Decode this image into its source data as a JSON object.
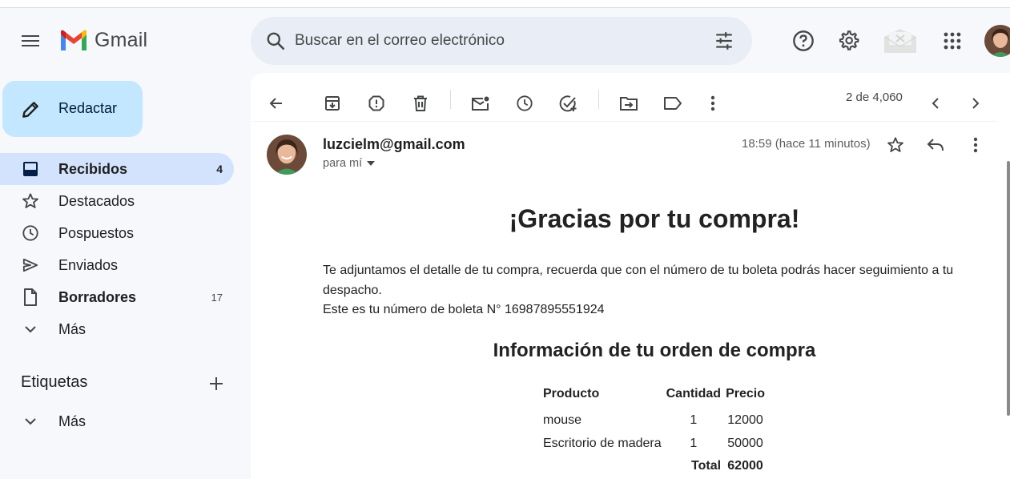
{
  "header": {
    "app_name": "Gmail",
    "search_placeholder": "Buscar en el correo electrónico",
    "icons": [
      "menu-icon",
      "search-icon",
      "tune-icon",
      "help-icon",
      "gear-icon",
      "envelope-icon",
      "apps-icon",
      "avatar"
    ]
  },
  "sidebar": {
    "compose_label": "Redactar",
    "items": [
      {
        "label": "Recibidos",
        "count": "4",
        "icon": "inbox-icon",
        "active": true
      },
      {
        "label": "Destacados",
        "count": "",
        "icon": "star-icon"
      },
      {
        "label": "Pospuestos",
        "count": "",
        "icon": "clock-icon"
      },
      {
        "label": "Enviados",
        "count": "",
        "icon": "send-icon"
      },
      {
        "label": "Borradores",
        "count": "17",
        "icon": "draft-icon"
      },
      {
        "label": "Más",
        "count": "",
        "icon": "chevron-down-icon"
      }
    ],
    "labels_title": "Etiquetas",
    "labels_more": "Más"
  },
  "toolbar": {
    "pager": "2 de 4,060"
  },
  "message": {
    "sender": "luzcielm@gmail.com",
    "to": "para mí",
    "time": "18:59 (hace 11 minutos)",
    "title": "¡Gracias por tu compra!",
    "line1": "Te adjuntamos el detalle de tu compra, recuerda que con el número de tu boleta podrás hacer seguimiento a tu despacho.",
    "line2": "Este es tu número de boleta N° 16987895551924",
    "subtitle": "Información de tu orden de compra",
    "table": {
      "headers": [
        "Producto",
        "Cantidad",
        "Precio"
      ],
      "rows": [
        [
          "mouse",
          "1",
          "12000"
        ],
        [
          "Escritorio de madera",
          "1",
          "50000"
        ]
      ],
      "total_label": "Total",
      "total_value": "62000"
    }
  },
  "colors": {
    "background": "#f6f8fc",
    "compose": "#c2e7ff",
    "active_nav": "#d3e3fd",
    "search_bg": "#e9eef6"
  }
}
